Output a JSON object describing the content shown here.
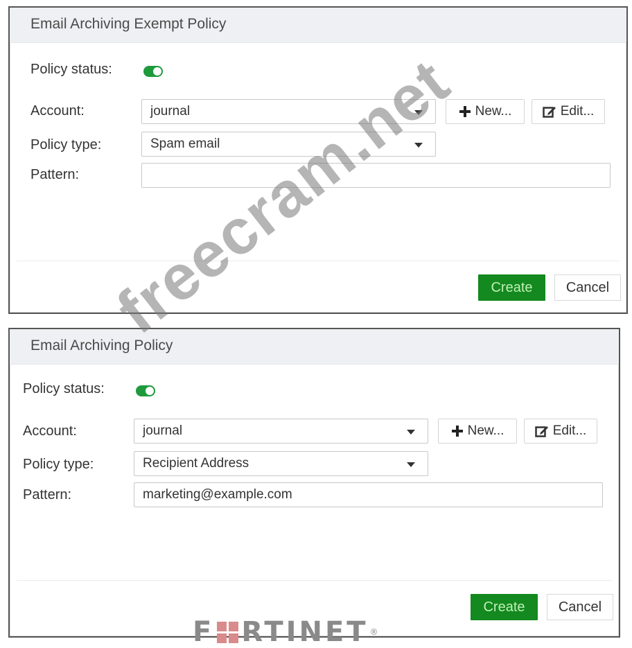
{
  "dialogs": [
    {
      "title": "Email Archiving Exempt Policy",
      "policy_status_label": "Policy status:",
      "policy_status_enabled": true,
      "account_label": "Account:",
      "account_value": "journal",
      "new_label": "New...",
      "edit_label": "Edit...",
      "policy_type_label": "Policy type:",
      "policy_type_value": "Spam email",
      "pattern_label": "Pattern:",
      "pattern_value": "",
      "create_label": "Create",
      "cancel_label": "Cancel"
    },
    {
      "title": "Email Archiving Policy",
      "policy_status_label": "Policy status:",
      "policy_status_enabled": true,
      "account_label": "Account:",
      "account_value": "journal",
      "new_label": "New...",
      "edit_label": "Edit...",
      "policy_type_label": "Policy type:",
      "policy_type_value": "Recipient Address",
      "pattern_label": "Pattern:",
      "pattern_value": "marketing@example.com",
      "create_label": "Create",
      "cancel_label": "Cancel"
    }
  ],
  "watermark": "freecram.net",
  "logo": {
    "text_before": "F",
    "text_after": "RTINET",
    "registered": "®"
  },
  "colors": {
    "toggle_on": "#1e9a3c",
    "create_button": "#13891f",
    "header_bg": "#eef0f3"
  }
}
